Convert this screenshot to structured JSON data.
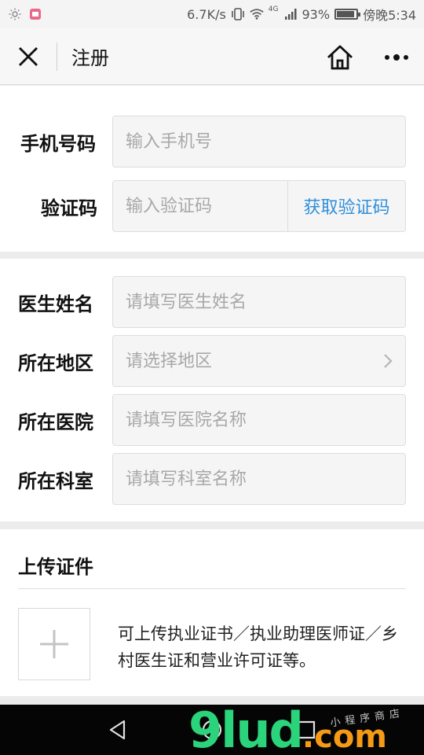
{
  "status_bar": {
    "net_speed": "6.7K/s",
    "network": "4G",
    "battery_percent": "93%",
    "battery_level": 0.93,
    "time": "傍晚5:34"
  },
  "nav": {
    "title": "注册"
  },
  "phone_section": {
    "phone_label": "手机号码",
    "phone_placeholder": "输入手机号",
    "code_label": "验证码",
    "code_placeholder": "输入验证码",
    "get_code_label": "获取验证码"
  },
  "doctor_section": {
    "name_label": "医生姓名",
    "name_placeholder": "请填写医生姓名",
    "region_label": "所在地区",
    "region_placeholder": "请选择地区",
    "hospital_label": "所在医院",
    "hospital_placeholder": "请填写医院名称",
    "department_label": "所在科室",
    "department_placeholder": "请填写科室名称"
  },
  "upload_section": {
    "title": "上传证件",
    "description": "可上传执业证书／执业助理医师证／乡村医生证和营业许可证等。"
  },
  "watermark": {
    "main": "9lud",
    "suffix": ".com",
    "small": "小程序商店"
  },
  "colors": {
    "accent_blue": "#2f8fdb",
    "watermark_green": "#2bd37a",
    "watermark_orange": "#f59a16"
  }
}
